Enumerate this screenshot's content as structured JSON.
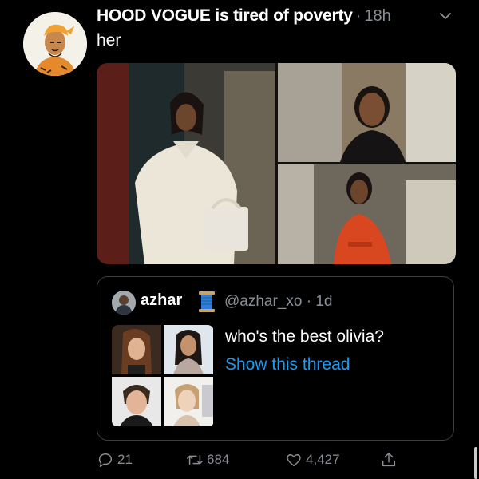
{
  "tweet": {
    "author_name": "HOOD VOGUE is tired of poverty",
    "separator": "·",
    "time": "18h",
    "text": "her"
  },
  "quoted": {
    "name": "azhar",
    "handle": "@azhar_xo",
    "separator": "·",
    "time": "1d",
    "text": "who's the best olivia?",
    "link": "Show this thread"
  },
  "actions": {
    "replies": "21",
    "retweets": "684",
    "likes": "4,427"
  },
  "colors": {
    "background": "#000000",
    "link": "#1d9bf0",
    "muted": "#8a8f96"
  },
  "icons": [
    "chevron-down-icon",
    "reply-icon",
    "retweet-icon",
    "like-icon",
    "share-icon",
    "thread-spool-icon"
  ]
}
